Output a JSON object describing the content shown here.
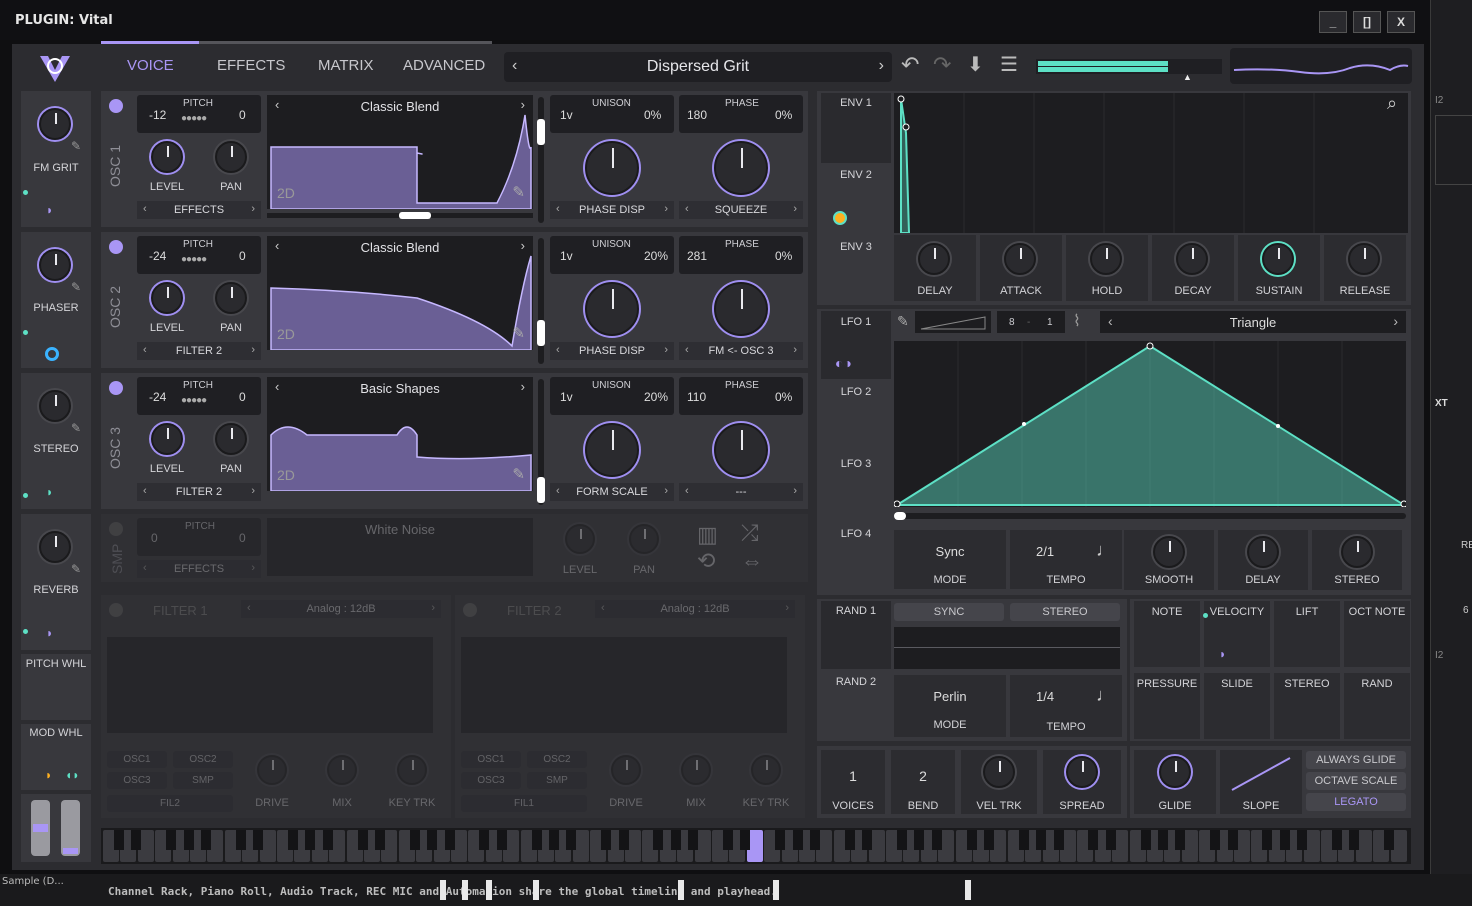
{
  "window": {
    "title": "PLUGIN: Vital",
    "buttons": [
      "_",
      "[]",
      "X"
    ]
  },
  "tabs": [
    "VOICE",
    "EFFECTS",
    "MATRIX",
    "ADVANCED"
  ],
  "active_tab": "VOICE",
  "preset": {
    "name": "Dispersed Grit"
  },
  "macros": [
    {
      "label": "FM GRIT"
    },
    {
      "label": "PHASER"
    },
    {
      "label": "STEREO"
    },
    {
      "label": "REVERB"
    }
  ],
  "wheels": {
    "pitch": "PITCH WHL",
    "mod": "MOD WHL"
  },
  "oscillators": [
    {
      "id": "OSC 1",
      "pitch_semi": "-12",
      "pitch_fine": "0",
      "pitch_label": "PITCH",
      "wavetable": "Classic Blend",
      "dim": "2D",
      "unison_voices": "1v",
      "unison_label": "UNISON",
      "unison_detune": "0%",
      "phase": "180",
      "phase_label": "PHASE",
      "phase_rand": "0%",
      "level": "LEVEL",
      "pan": "PAN",
      "dest": "EFFECTS",
      "warp1": "PHASE DISP",
      "warp2": "SQUEEZE"
    },
    {
      "id": "OSC 2",
      "pitch_semi": "-24",
      "pitch_fine": "0",
      "pitch_label": "PITCH",
      "wavetable": "Classic Blend",
      "dim": "2D",
      "unison_voices": "1v",
      "unison_label": "UNISON",
      "unison_detune": "20%",
      "phase": "281",
      "phase_label": "PHASE",
      "phase_rand": "0%",
      "level": "LEVEL",
      "pan": "PAN",
      "dest": "FILTER 2",
      "warp1": "PHASE DISP",
      "warp2": "FM <- OSC 3"
    },
    {
      "id": "OSC 3",
      "pitch_semi": "-24",
      "pitch_fine": "0",
      "pitch_label": "PITCH",
      "wavetable": "Basic Shapes",
      "dim": "2D",
      "unison_voices": "1v",
      "unison_label": "UNISON",
      "unison_detune": "20%",
      "phase": "110",
      "phase_label": "PHASE",
      "phase_rand": "0%",
      "level": "LEVEL",
      "pan": "PAN",
      "dest": "FILTER 2",
      "warp1": "FORM SCALE",
      "warp2": "---"
    }
  ],
  "sampler": {
    "id": "SMP",
    "pitch_semi": "0",
    "pitch_fine": "0",
    "pitch_label": "PITCH",
    "sample": "White Noise",
    "dest": "EFFECTS",
    "level": "LEVEL",
    "pan": "PAN"
  },
  "filters": [
    {
      "name": "FILTER 1",
      "model": "Analog : 12dB",
      "src": [
        "OSC1",
        "OSC2",
        "OSC3",
        "SMP",
        "FIL2"
      ],
      "knobs": [
        "DRIVE",
        "MIX",
        "KEY TRK"
      ]
    },
    {
      "name": "FILTER 2",
      "model": "Analog : 12dB",
      "src": [
        "OSC1",
        "OSC2",
        "OSC3",
        "SMP",
        "FIL1"
      ],
      "knobs": [
        "DRIVE",
        "MIX",
        "KEY TRK"
      ]
    }
  ],
  "envelopes": {
    "tabs": [
      "ENV 1",
      "ENV 2",
      "ENV 3"
    ],
    "knobs": [
      "DELAY",
      "ATTACK",
      "HOLD",
      "DECAY",
      "SUSTAIN",
      "RELEASE"
    ]
  },
  "lfos": {
    "tabs": [
      "LFO 1",
      "LFO 2",
      "LFO 3",
      "LFO 4"
    ],
    "grid_x": "8",
    "grid_y": "1",
    "shape": "Triangle",
    "mode": "Sync",
    "mode_label": "MODE",
    "tempo": "2/1",
    "tempo_label": "TEMPO",
    "knobs": [
      "SMOOTH",
      "DELAY",
      "STEREO"
    ]
  },
  "randoms": {
    "tabs": [
      "RAND 1",
      "RAND 2"
    ],
    "sync": "SYNC",
    "stereo": "STEREO",
    "mode": "Perlin",
    "mode_label": "MODE",
    "tempo": "1/4",
    "tempo_label": "TEMPO"
  },
  "mod_sources": [
    [
      "NOTE",
      "VELOCITY",
      "LIFT",
      "OCT NOTE"
    ],
    [
      "PRESSURE",
      "SLIDE",
      "STEREO",
      "RAND"
    ]
  ],
  "voice": {
    "voices": "1",
    "voices_label": "VOICES",
    "bend": "2",
    "bend_label": "BEND",
    "vel_trk": "VEL TRK",
    "spread": "SPREAD"
  },
  "glide": {
    "glide": "GLIDE",
    "slope": "SLOPE",
    "opts": [
      "ALWAYS GLIDE",
      "OCTAVE SCALE",
      "LEGATO"
    ]
  },
  "taskbar": {
    "left": "Sample (D...",
    "message": "Channel Rack, Piano Roll, Audio Track, REC MIC and Automation share the global timeline and playhead."
  },
  "right_edge": [
    "I2",
    "XT",
    "RE",
    "6",
    "I2"
  ],
  "colors": {
    "accent_purple": "#a996f5",
    "accent_teal": "#5de0c5",
    "panel": "#38383d",
    "bg": "#2c2c30"
  }
}
